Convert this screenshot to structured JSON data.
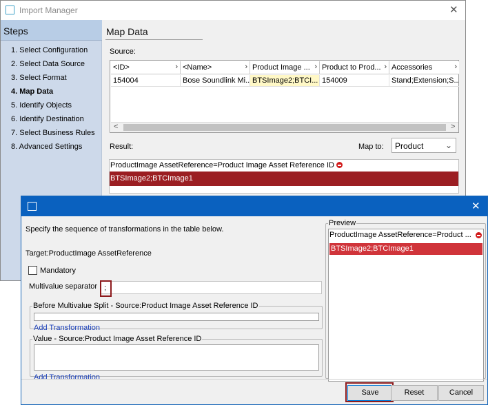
{
  "background_window": {
    "title": "Import Manager",
    "steps_title": "Steps",
    "steps": [
      "1. Select Configuration",
      "2. Select Data Source",
      "3. Select Format",
      "4. Map Data",
      "5. Identify Objects",
      "6. Identify Destination",
      "7. Select Business Rules",
      "8. Advanced Settings"
    ],
    "active_step_index": 3,
    "page_title": "Map Data",
    "source_label": "Source:",
    "source_table": {
      "columns": [
        "<ID>",
        "<Name>",
        "Product Image ...",
        "Product to Prod...",
        "Accessories"
      ],
      "row": [
        "154004",
        "Bose Soundlink Mi...",
        "BTSImage2;BTCI...",
        "154009",
        "Stand;Extension;S..."
      ]
    },
    "result_label": "Result:",
    "map_to_label": "Map to:",
    "map_to_value": "Product",
    "result_header": "ProductImage AssetReference=Product Image Asset Reference ID",
    "result_value": "BTSImage2;BTCImage1"
  },
  "dialog": {
    "instruction": "Specify the sequence of transformations in the table below.",
    "target": "Target:ProductImage AssetReference",
    "mandatory_label": "Mandatory",
    "mandatory_checked": false,
    "multivalue_separator_label": "Multivalue separator",
    "multivalue_separator_value": ";",
    "before_split_legend": "Before Multivalue Split - Source:Product Image Asset Reference ID",
    "value_legend": "Value - Source:Product Image Asset Reference ID",
    "add_transformation": "Add Transformation",
    "preview_legend": "Preview",
    "preview_header": "ProductImage AssetReference=Product ...",
    "preview_value": "BTSImage2;BTCImage1",
    "buttons": {
      "save": "Save",
      "reset": "Reset",
      "cancel": "Cancel"
    }
  },
  "colors": {
    "dialog_titlebar": "#0a61bf",
    "result_row": "#9b1e22",
    "preview_row": "#d0343a",
    "steps_panel": "#cdd9ea",
    "highlight_frame": "#8d1a1d"
  }
}
